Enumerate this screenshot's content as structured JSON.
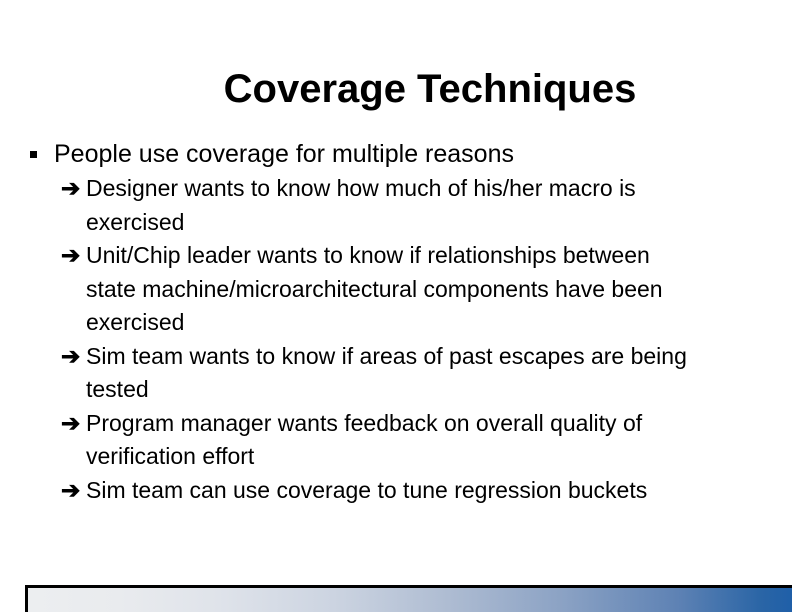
{
  "slide": {
    "title": "Coverage Techniques",
    "bullets": [
      {
        "level1": "People use coverage for multiple reasons",
        "marker": "square-bullet",
        "sub_bullets": [
          {
            "marker": "arrow-bullet",
            "lines": [
              "Designer wants to know how much of his/her macro is",
              "exercised"
            ]
          },
          {
            "marker": "arrow-bullet",
            "lines": [
              "Unit/Chip leader wants to know if relationships between",
              "state machine/microarchitectural components have been",
              "exercised"
            ]
          },
          {
            "marker": "arrow-bullet",
            "lines": [
              "Sim team wants to know if areas of past escapes are being",
              "tested"
            ]
          },
          {
            "marker": "arrow-bullet",
            "lines": [
              "Program manager wants feedback on overall quality of",
              "verification effort"
            ]
          },
          {
            "marker": "arrow-bullet",
            "lines": [
              "Sim team can use coverage to tune regression buckets"
            ]
          }
        ]
      }
    ],
    "arrow_glyph": "➔",
    "footer": {
      "name": "gradient-accent-bar",
      "gradient_from": "#eceef0",
      "gradient_mid": "#aebcd2",
      "gradient_to": "#1f5fa8",
      "border_color": "#000000"
    },
    "background_color": "#ffffff",
    "text_color": "#000000"
  }
}
